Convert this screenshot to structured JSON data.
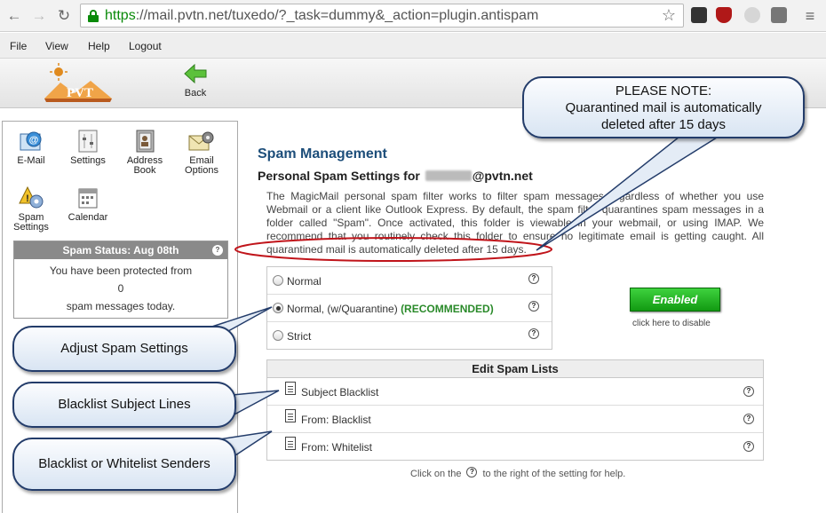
{
  "browser": {
    "url_secure": "https",
    "url_rest": "://mail.pvtn.net/tuxedo/?_task=dummy&_action=plugin.antispam"
  },
  "menu": {
    "file": "File",
    "view": "View",
    "help": "Help",
    "logout": "Logout"
  },
  "toolbar": {
    "logo_text": "PVT",
    "back_label": "Back"
  },
  "sidebar": {
    "email": "E-Mail",
    "settings": "Settings",
    "address_book_1": "Address",
    "address_book_2": "Book",
    "email_options_1": "Email",
    "email_options_2": "Options",
    "spam_settings_1": "Spam",
    "spam_settings_2": "Settings",
    "calendar": "Calendar"
  },
  "status": {
    "title": "Spam Status: Aug 08th",
    "line1": "You have been protected from",
    "count": "0",
    "line3": "spam messages today."
  },
  "main": {
    "title": "Spam Management",
    "subtitle_prefix": "Personal Spam Settings for ",
    "subtitle_suffix": "@pvtn.net",
    "description": "The MagicMail personal spam filter works to filter spam messages regardless of whether you use Webmail or a client like Outlook Express. By default, the spam filter quarantines spam messages in a folder called \"Spam\". Once activated, this folder is viewable in your webmail, or using IMAP. We recommend that you routinely check this folder to ensure no legitimate email is getting caught. All quarantined mail is automatically deleted after 15 days."
  },
  "options": {
    "normal": "Normal",
    "quarantine": "Normal, (w/Quarantine)",
    "recommended": "(RECOMMENDED)",
    "strict": "Strict"
  },
  "enabled": {
    "label": "Enabled",
    "hint": "click here to disable"
  },
  "lists": {
    "title": "Edit Spam Lists",
    "subject_blacklist": "Subject Blacklist",
    "from_blacklist": "From: Blacklist",
    "from_whitelist": "From: Whitelist"
  },
  "help": {
    "prefix": "Click on the",
    "suffix": "to the right of the setting for help.",
    "qmark": "?"
  },
  "callouts": {
    "note_1": "PLEASE NOTE:",
    "note_2": "Quarantined mail is automatically",
    "note_3": "deleted after 15 days",
    "adjust": "Adjust Spam Settings",
    "blacklist_subject": "Blacklist Subject Lines",
    "black_white": "Blacklist or Whitelist Senders"
  },
  "colors": {
    "accent_title": "#1d4e7a",
    "enabled_green": "#129a12",
    "recommended": "#2a8a2a",
    "callout_border": "#233c6a",
    "highlight_oval": "#c0141a"
  }
}
